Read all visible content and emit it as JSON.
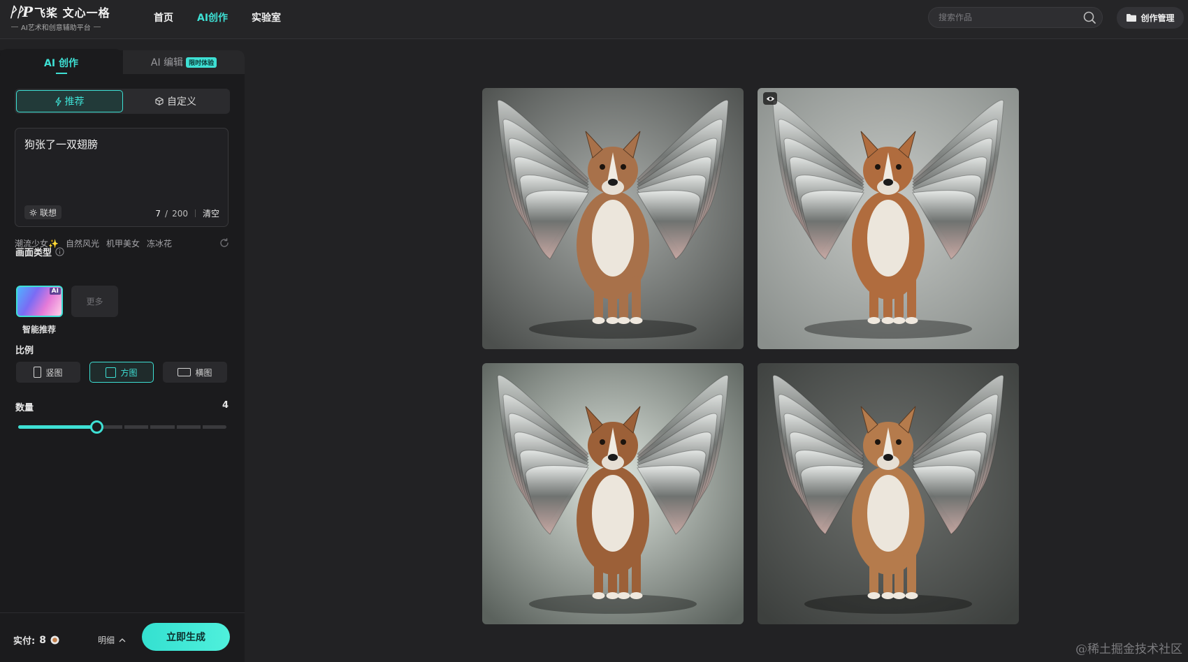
{
  "header": {
    "logo_mark": "ᚹᚹP",
    "logo_title": "飞桨 文心一格",
    "logo_subtitle": "AI艺术和创意辅助平台",
    "nav": [
      {
        "label": "首页",
        "active": false
      },
      {
        "label": "AI创作",
        "active": true
      },
      {
        "label": "实验室",
        "active": false
      }
    ],
    "search_placeholder": "搜索作品",
    "manage_label": "创作管理"
  },
  "panel": {
    "tabs": {
      "create_label": "AI 创作",
      "edit_label": "AI 编辑",
      "edit_badge": "限时体验"
    },
    "modes": [
      {
        "label": "推荐",
        "icon": "lightning-icon",
        "active": true
      },
      {
        "label": "自定义",
        "icon": "cube-icon",
        "active": false
      }
    ],
    "prompt": {
      "text": "狗张了一双翅膀",
      "assoc_label": "联想",
      "count_current": "7",
      "count_slash": "/",
      "count_max": "200",
      "clear_label": "清空"
    },
    "suggestions": [
      "潮流少女✨",
      "自然风光",
      "机甲美女",
      "冻冰花"
    ],
    "type_section": {
      "title": "画面类型",
      "smart_label": "智能推荐",
      "smart_tag": "AI",
      "more_label": "更多"
    },
    "ratio_section": {
      "title": "比例",
      "options": [
        {
          "label": "竖图",
          "active": false
        },
        {
          "label": "方图",
          "active": true
        },
        {
          "label": "横图",
          "active": false
        }
      ]
    },
    "quantity_section": {
      "title": "数量",
      "value": "4",
      "min": 1,
      "max": 9,
      "current": 4
    },
    "footer": {
      "pay_label": "实付:",
      "pay_amount": "8",
      "detail_label": "明细",
      "generate_label": "立即生成"
    }
  },
  "gallery": {
    "images": [
      {
        "name": "winged-dog-standing",
        "dog_color": "#a8714a"
      },
      {
        "name": "winged-dog-sitting",
        "dog_color": "#b06c3e"
      },
      {
        "name": "winged-dog-walking",
        "dog_color": "#9c6038"
      },
      {
        "name": "winged-dog-sitting-dark",
        "dog_color": "#b57b4c"
      }
    ]
  },
  "watermark": "@稀土掘金技术社区",
  "colors": {
    "accent": "#3ee0d4",
    "background": "#222224",
    "panel": "#1b1b1d"
  }
}
